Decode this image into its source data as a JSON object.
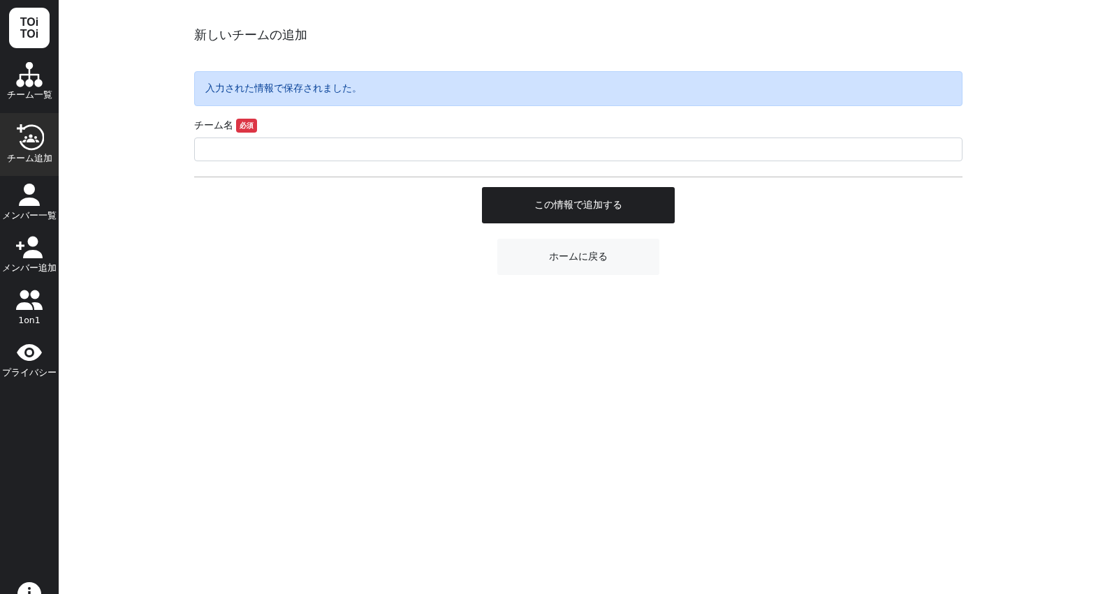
{
  "sidebar": {
    "logo": [
      "TOi",
      "TOi"
    ],
    "items": [
      {
        "kind": "org",
        "label": "チーム一覧",
        "selected": false
      },
      {
        "kind": "team-add",
        "label": "チーム追加",
        "selected": true
      },
      {
        "kind": "person",
        "label": "メンバー一覧",
        "selected": false
      },
      {
        "kind": "person-add",
        "label": "メンバー追加",
        "selected": false
      },
      {
        "kind": "people",
        "label": "1on1",
        "selected": false
      },
      {
        "kind": "eye",
        "label": "プライバシー",
        "selected": false
      }
    ]
  },
  "page": {
    "title": "新しいチームの追加",
    "alert": "入力された情報で保存されました。",
    "field": {
      "label": "チーム名",
      "badge": "必須"
    },
    "primary_button": "この情報で追加する",
    "secondary_button": "ホームに戻る"
  }
}
